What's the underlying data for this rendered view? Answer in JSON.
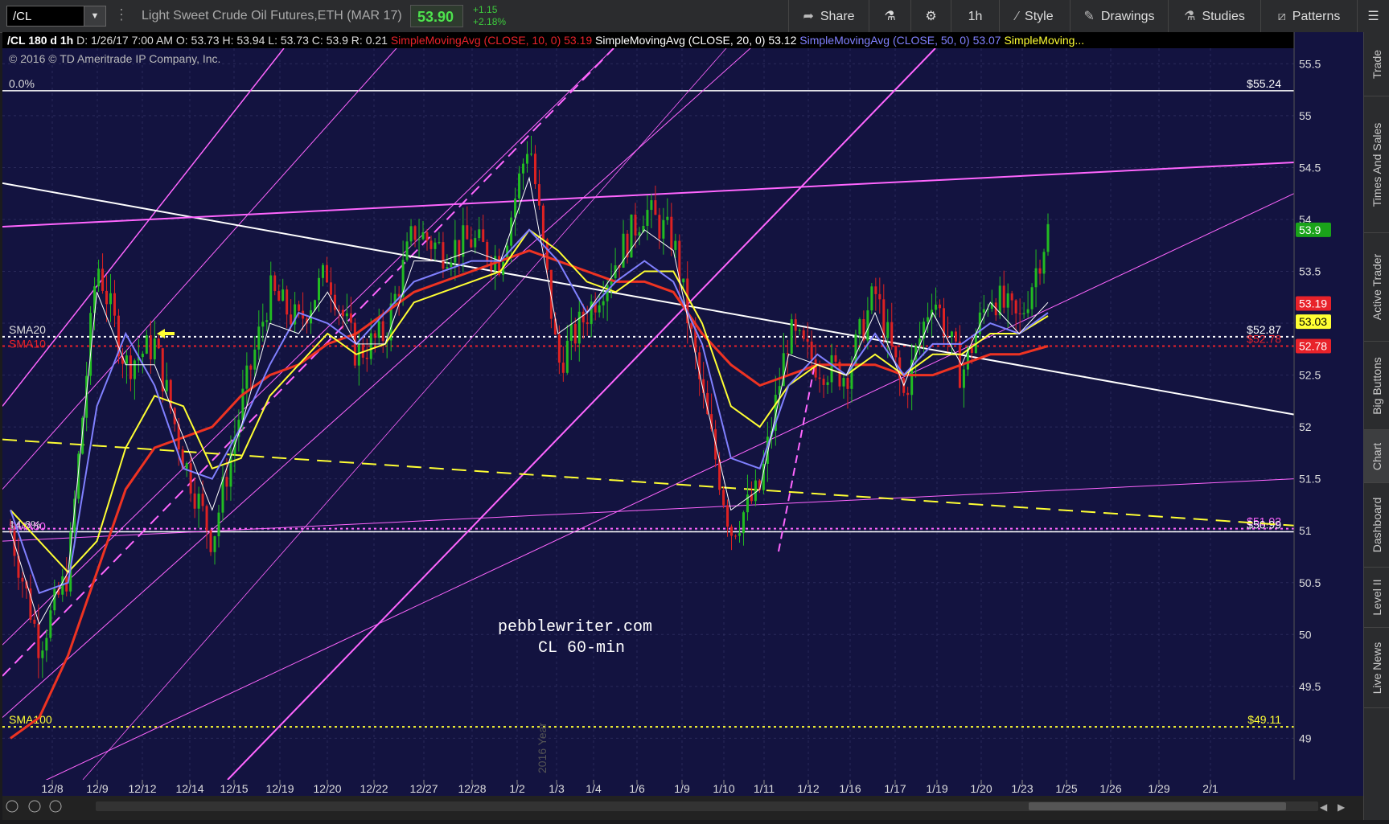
{
  "toolbar": {
    "symbol": "/CL",
    "description": "Light Sweet Crude Oil Futures,ETH (MAR 17)",
    "last_price": "53.90",
    "change": "+1.15",
    "change_pct": "+2.18%",
    "share_label": "Share",
    "interval_label": "1h",
    "style_label": "Style",
    "drawings_label": "Drawings",
    "studies_label": "Studies",
    "patterns_label": "Patterns"
  },
  "sidebar": {
    "tabs": [
      "Trade",
      "Times And Sales",
      "Active Trader",
      "Big Buttons",
      "Chart",
      "Dashboard",
      "Level II",
      "Live News"
    ],
    "active": "Chart"
  },
  "chart_data": {
    "type": "candlestick",
    "header": {
      "symbol_interval": "/CL 180 d 1h",
      "date": "D: 1/26/17 7:00 AM",
      "open": "O: 53.73",
      "high": "H: 53.94",
      "low": "L: 53.73",
      "close": "C: 53.9",
      "range": "R: 0.21"
    },
    "studies": [
      {
        "label": "SimpleMovingAvg (CLOSE, 10, 0)",
        "value": "53.19",
        "color": "#e8222a"
      },
      {
        "label": "SimpleMovingAvg (CLOSE, 20, 0)",
        "value": "53.12",
        "color": "#ffffff"
      },
      {
        "label": "SimpleMovingAvg (CLOSE, 50, 0)",
        "value": "53.07",
        "color": "#8080ff"
      },
      {
        "label": "SimpleMoving...",
        "value": "",
        "color": "#ffff33"
      }
    ],
    "copyright": "© 2016 © TD Ameritrade IP Company, Inc.",
    "watermark": [
      "pebblewriter.com",
      "CL 60-min"
    ],
    "year_label": "2016 Year",
    "y_ticks": [
      "55.5",
      "55",
      "54.5",
      "54",
      "53.5",
      "53",
      "52.5",
      "52",
      "51.5",
      "51",
      "50.5",
      "50",
      "49.5",
      "49"
    ],
    "ylim": [
      48.6,
      55.65
    ],
    "x_ticks": [
      "12/8",
      "12/9",
      "12/12",
      "12/14",
      "12/15",
      "12/19",
      "12/20",
      "12/22",
      "12/27",
      "12/28",
      "1/2",
      "1/3",
      "1/4",
      "1/6",
      "1/9",
      "1/10",
      "1/11",
      "1/12",
      "1/16",
      "1/17",
      "1/19",
      "1/20",
      "1/23",
      "1/25",
      "1/26",
      "1/29",
      "2/1"
    ],
    "price_badges": [
      {
        "text": "53.9",
        "value": 53.9,
        "bg": "#1aa31a",
        "fg": "#ffffff"
      },
      {
        "text": "53.19",
        "value": 53.19,
        "bg": "#e8222a",
        "fg": "#ffffff"
      },
      {
        "text": "53.03",
        "value": 53.03,
        "bg": "#ffff33",
        "fg": "#000000"
      },
      {
        "text": "52.78",
        "value": 52.78,
        "bg": "#e8222a",
        "fg": "#ffffff"
      }
    ],
    "horizontal_levels": [
      {
        "left_label": "0.0%",
        "right_label": "$55.24",
        "value": 55.24,
        "color": "#ffffff",
        "style": "solid"
      },
      {
        "left_label": "SMA20",
        "right_label": "$52.87",
        "value": 52.87,
        "color": "#ffffff",
        "style": "dotted"
      },
      {
        "left_label": "SMA10",
        "right_label": "$52.78",
        "value": 52.78,
        "color": "#e8222a",
        "style": "dotted"
      },
      {
        "left_label": "SMA50",
        "right_label": "$51.02",
        "value": 51.02,
        "color": "#ff66ff",
        "style": "dotted"
      },
      {
        "left_label": "14.6%",
        "right_label": "$50.99",
        "value": 50.99,
        "color": "#ffffff",
        "style": "solid"
      },
      {
        "left_label": "SMA100",
        "right_label": "$49.11",
        "value": 49.11,
        "color": "#ffff33",
        "style": "dotted"
      }
    ],
    "series_close_approx": [
      51.0,
      49.9,
      50.6,
      53.6,
      52.6,
      52.8,
      51.7,
      50.9,
      52.2,
      53.3,
      53.0,
      53.5,
      52.7,
      52.9,
      53.9,
      53.7,
      53.8,
      53.6,
      54.8,
      52.6,
      53.1,
      53.6,
      54.1,
      53.8,
      52.3,
      51.0,
      51.4,
      52.9,
      52.6,
      52.5,
      53.3,
      52.3,
      53.3,
      52.5,
      53.3,
      53.0,
      53.9
    ],
    "sma10_approx": [
      51.0,
      50.1,
      50.6,
      53.3,
      52.6,
      52.6,
      51.9,
      51.2,
      52.0,
      53.0,
      52.9,
      53.3,
      52.8,
      52.8,
      53.6,
      53.6,
      53.7,
      53.6,
      54.4,
      52.9,
      53.1,
      53.5,
      53.9,
      53.7,
      52.4,
      51.2,
      51.4,
      52.7,
      52.6,
      52.5,
      53.1,
      52.4,
      53.1,
      52.6,
      53.2,
      52.9,
      53.2
    ],
    "sma20_approx": [
      51.2,
      50.4,
      50.5,
      52.2,
      52.9,
      52.4,
      51.6,
      51.5,
      52.0,
      52.6,
      53.1,
      53.0,
      52.8,
      53.1,
      53.4,
      53.5,
      53.6,
      53.6,
      53.9,
      53.6,
      53.1,
      53.4,
      53.6,
      53.4,
      52.8,
      51.7,
      51.6,
      52.4,
      52.7,
      52.5,
      52.9,
      52.5,
      52.8,
      52.8,
      53.0,
      52.9,
      53.1
    ],
    "sma50_approx": [
      51.2,
      50.9,
      50.6,
      50.9,
      51.8,
      52.3,
      52.2,
      51.6,
      51.7,
      52.3,
      52.6,
      52.9,
      52.7,
      52.8,
      53.2,
      53.3,
      53.4,
      53.5,
      53.9,
      53.7,
      53.4,
      53.3,
      53.5,
      53.5,
      53.0,
      52.2,
      52.0,
      52.4,
      52.6,
      52.5,
      52.7,
      52.5,
      52.7,
      52.7,
      52.9,
      52.9,
      53.07
    ],
    "sma100_approx": [
      49.0,
      49.2,
      49.8,
      50.6,
      51.4,
      51.8,
      51.9,
      52.0,
      52.3,
      52.5,
      52.6,
      52.8,
      52.9,
      53.1,
      53.3,
      53.4,
      53.5,
      53.6,
      53.7,
      53.6,
      53.5,
      53.4,
      53.4,
      53.3,
      52.9,
      52.6,
      52.4,
      52.5,
      52.6,
      52.6,
      52.6,
      52.5,
      52.5,
      52.6,
      52.7,
      52.7,
      52.78
    ],
    "trendlines": [
      {
        "color": "#ffffff",
        "style": "solid",
        "from": [
          "12/8",
          54.35
        ],
        "to": [
          "2/1",
          52.12
        ]
      },
      {
        "color": "#ff66ff",
        "style": "solid",
        "from": [
          "12/8",
          53.93
        ],
        "to": [
          "2/1",
          54.55
        ]
      },
      {
        "color": "#ffff33",
        "style": "dashed",
        "from": [
          "12/8",
          51.88
        ],
        "to": [
          "2/1",
          51.05
        ]
      }
    ],
    "grid": true,
    "background": "#131340"
  }
}
